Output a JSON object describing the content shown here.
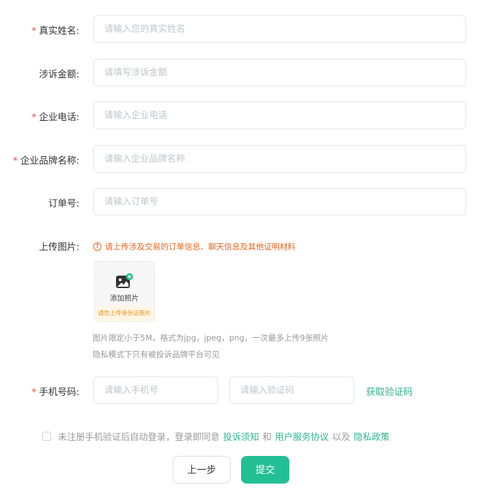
{
  "form": {
    "fields": [
      {
        "label": "真实姓名:",
        "required": true,
        "placeholder": "请输入您的真实姓名"
      },
      {
        "label": "涉诉金额:",
        "required": false,
        "placeholder": "请填写涉诉金额"
      },
      {
        "label": "企业电话:",
        "required": true,
        "placeholder": "请输入企业电话"
      },
      {
        "label": "企业品牌名称:",
        "required": true,
        "placeholder": "请输入企业品牌名称"
      },
      {
        "label": "订单号:",
        "required": false,
        "placeholder": "请输入订单号"
      }
    ],
    "required_mark": "*",
    "upload": {
      "label": "上传图片:",
      "warning_icon": "!",
      "warning": "请上传涉及交易的订单信息、聊天信息及其他证明材料",
      "button_text": "添加照片",
      "tip": "请勿上传身份证照片",
      "hint1": "图片限定小于5M，格式为jpg，jpeg，png，一次最多上传9张照片",
      "hint2": "隐私模式下只有被投诉品牌平台可见"
    },
    "phone": {
      "label": "手机号码:",
      "required": true,
      "phone_placeholder": "请输入手机号",
      "code_placeholder": "请输入验证码",
      "get_code": "获取验证码"
    },
    "agreement": {
      "text": "未注册手机验证后自动登录，登录即同意",
      "link1": "投诉须知",
      "and": "和",
      "link2": "用户服务协议",
      "also": "以及",
      "link3": "隐私政策"
    },
    "buttons": {
      "prev": "上一步",
      "submit": "提交"
    }
  },
  "colors": {
    "accent": "#23bf95",
    "link": "#2bb58a",
    "required": "#e5473c",
    "warning": "#e8641b"
  }
}
